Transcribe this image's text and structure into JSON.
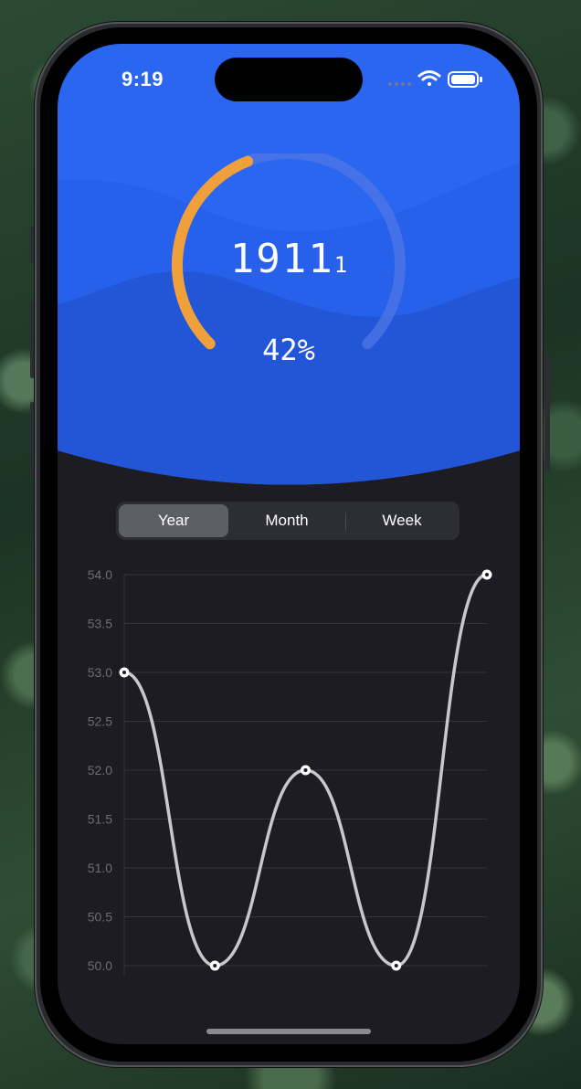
{
  "status_bar": {
    "time": "9:19"
  },
  "gauge": {
    "value": "1911",
    "unit": "1",
    "percent_text": "42%",
    "progress": 0.42,
    "track_color": "#4f77e6",
    "progress_color": "#f0a03a"
  },
  "segments": {
    "items": [
      {
        "label": "Year",
        "active": true
      },
      {
        "label": "Month",
        "active": false
      },
      {
        "label": "Week",
        "active": false
      }
    ]
  },
  "colors": {
    "header_blue": "#2a66f0",
    "wave_blue": "#2559d8",
    "screen_dark": "#1c1c22",
    "line": "#c8c8cc"
  },
  "chart_data": {
    "type": "line",
    "x": [
      1,
      2,
      3,
      4,
      5
    ],
    "values": [
      53.0,
      50.0,
      52.0,
      50.0,
      54.0
    ],
    "y_ticks": [
      "54.0",
      "53.5",
      "53.0",
      "52.5",
      "52.0",
      "51.5",
      "51.0",
      "50.5",
      "50.0"
    ],
    "ylim": [
      50.0,
      54.0
    ],
    "grid": true,
    "smooth": true,
    "markers": true
  }
}
